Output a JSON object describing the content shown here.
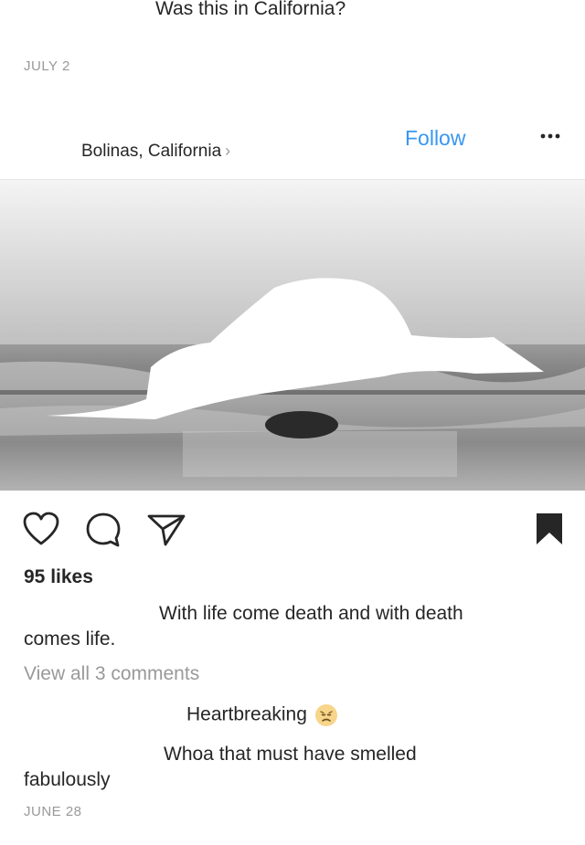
{
  "previous_post": {
    "comment_text": "Was this in California?",
    "date": "JULY 2"
  },
  "post": {
    "location": "Bolinas, California",
    "location_chevron": "›",
    "follow_label": "Follow",
    "more_icon": "more-horizontal-icon",
    "likes": "95 likes",
    "caption_line1": "With life come death and with death",
    "caption_line2": "comes life.",
    "view_all_comments": "View all 3 comments",
    "comments": [
      {
        "text": "Heartbreaking",
        "emoji": "disappointed-face-emoji"
      },
      {
        "text_line1": "Whoa that must have smelled",
        "text_line2": "fabulously"
      }
    ],
    "date": "JUNE 28"
  },
  "icons": {
    "like": "heart-icon",
    "comment": "comment-bubble-icon",
    "share": "paper-plane-icon",
    "save": "bookmark-icon"
  }
}
